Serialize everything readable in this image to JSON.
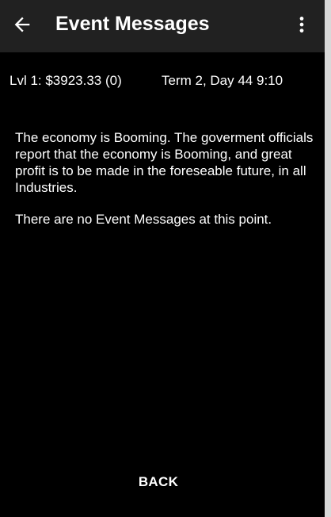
{
  "app_bar": {
    "back_icon": "arrow-left-icon",
    "title": "Event Messages",
    "menu_icon": "more-vert-icon",
    "background_color": "#212121"
  },
  "status": {
    "level_funds": "Lvl 1: $3923.33 (0)",
    "term_day_time": "Term 2, Day 44  9:10"
  },
  "messages": {
    "economy": "The economy is Booming. The goverment officials report that the economy is Booming, and great profit is to be made in the foreseable future, in all Industries.",
    "events": "There are no Event Messages at this point."
  },
  "footer": {
    "back_label": "BACK"
  }
}
